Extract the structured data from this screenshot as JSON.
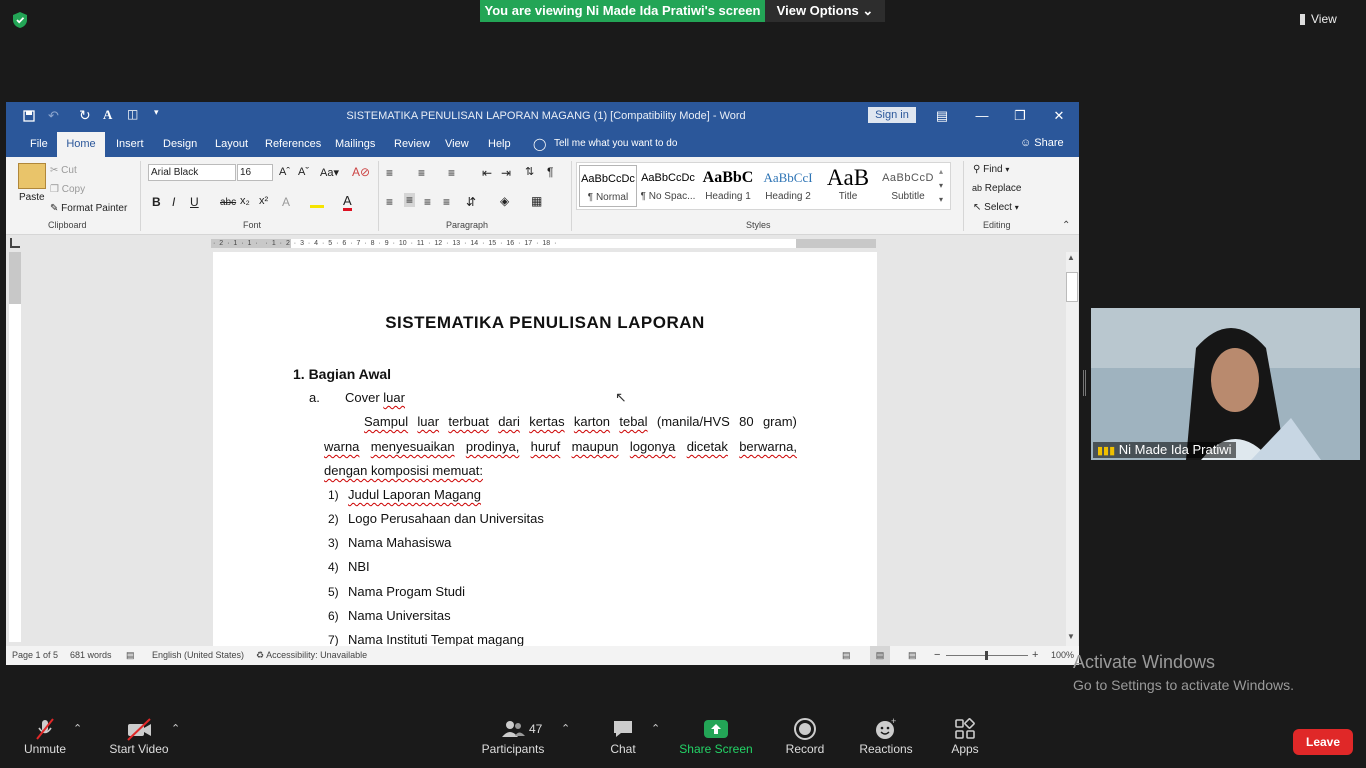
{
  "zoom": {
    "banner": "You are viewing Ni Made Ida Pratiwi's screen",
    "view_options": "View Options",
    "view": "View",
    "participant_name": "Ni Made Ida Pratiwi",
    "participants_count": "47",
    "toolbar": {
      "unmute": "Unmute",
      "start_video": "Start Video",
      "participants": "Participants",
      "chat": "Chat",
      "share_screen": "Share Screen",
      "record": "Record",
      "reactions": "Reactions",
      "apps": "Apps",
      "leave": "Leave"
    },
    "activate": {
      "title": "Activate Windows",
      "subtitle": "Go to Settings to activate Windows."
    }
  },
  "word": {
    "title": "SISTEMATIKA PENULISAN LAPORAN MAGANG (1) [Compatibility Mode]  -  Word",
    "sign_in": "Sign in",
    "tabs": [
      "File",
      "Home",
      "Insert",
      "Design",
      "Layout",
      "References",
      "Mailings",
      "Review",
      "View",
      "Help"
    ],
    "tell_me": "Tell me what you want to do",
    "share": "Share",
    "clipboard": {
      "paste": "Paste",
      "cut": "Cut",
      "copy": "Copy",
      "format_painter": "Format Painter",
      "label": "Clipboard"
    },
    "font": {
      "name": "Arial Black",
      "size": "16",
      "label": "Font"
    },
    "paragraph_label": "Paragraph",
    "styles_label": "Styles",
    "styles": [
      {
        "preview": "AaBbCcDc",
        "name": "¶ Normal"
      },
      {
        "preview": "AaBbCcDc",
        "name": "¶ No Spac..."
      },
      {
        "preview": "AaBbC",
        "name": "Heading 1"
      },
      {
        "preview": "AaBbCcI",
        "name": "Heading 2"
      },
      {
        "preview": "AaB",
        "name": "Title"
      },
      {
        "preview": "AaBbCcD",
        "name": "Subtitle"
      }
    ],
    "editing": {
      "find": "Find",
      "replace": "Replace",
      "select": "Select",
      "label": "Editing"
    },
    "ruler": "· 2 · 1 · 1 ·  · 1 · 2 · 3 · 4 · 5 · 6 · 7 · 8 · 9 · 10 · 11 · 12 · 13 · 14 · 15 · 16 · 17 · 18 ·",
    "status": {
      "page": "Page 1 of 5",
      "words": "681 words",
      "language": "English (United States)",
      "accessibility": "Accessibility: Unavailable",
      "zoom": "100%"
    },
    "doc": {
      "title": "SISTEMATIKA PENULISAN LAPORAN",
      "section": "1. Bagian Awal",
      "sub_marker": "a.",
      "sub_title_a": "Cover ",
      "sub_title_b": "luar",
      "para_line1": [
        "Sampul",
        "luar",
        "terbuat",
        "dari",
        "kertas",
        "karton",
        "tebal",
        "(manila/HVS",
        "80",
        "gram)"
      ],
      "para_line2": [
        "warna",
        "menyesuaikan",
        "prodinya,",
        "huruf",
        "maupun",
        "logonya",
        "dicetak",
        "berwarna,"
      ],
      "para_line3": "dengan komposisi memuat:",
      "items": [
        {
          "num": "1)",
          "text": "Judul Laporan Magang"
        },
        {
          "num": "2)",
          "text": "Logo Perusahaan dan Universitas"
        },
        {
          "num": "3)",
          "text": "Nama Mahasiswa"
        },
        {
          "num": "4)",
          "text": "NBI"
        },
        {
          "num": "5)",
          "text": "Nama Progam Studi"
        },
        {
          "num": "6)",
          "text": "Nama Universitas"
        },
        {
          "num": "7)",
          "text": "Nama Instituti Tempat magang"
        }
      ]
    }
  }
}
